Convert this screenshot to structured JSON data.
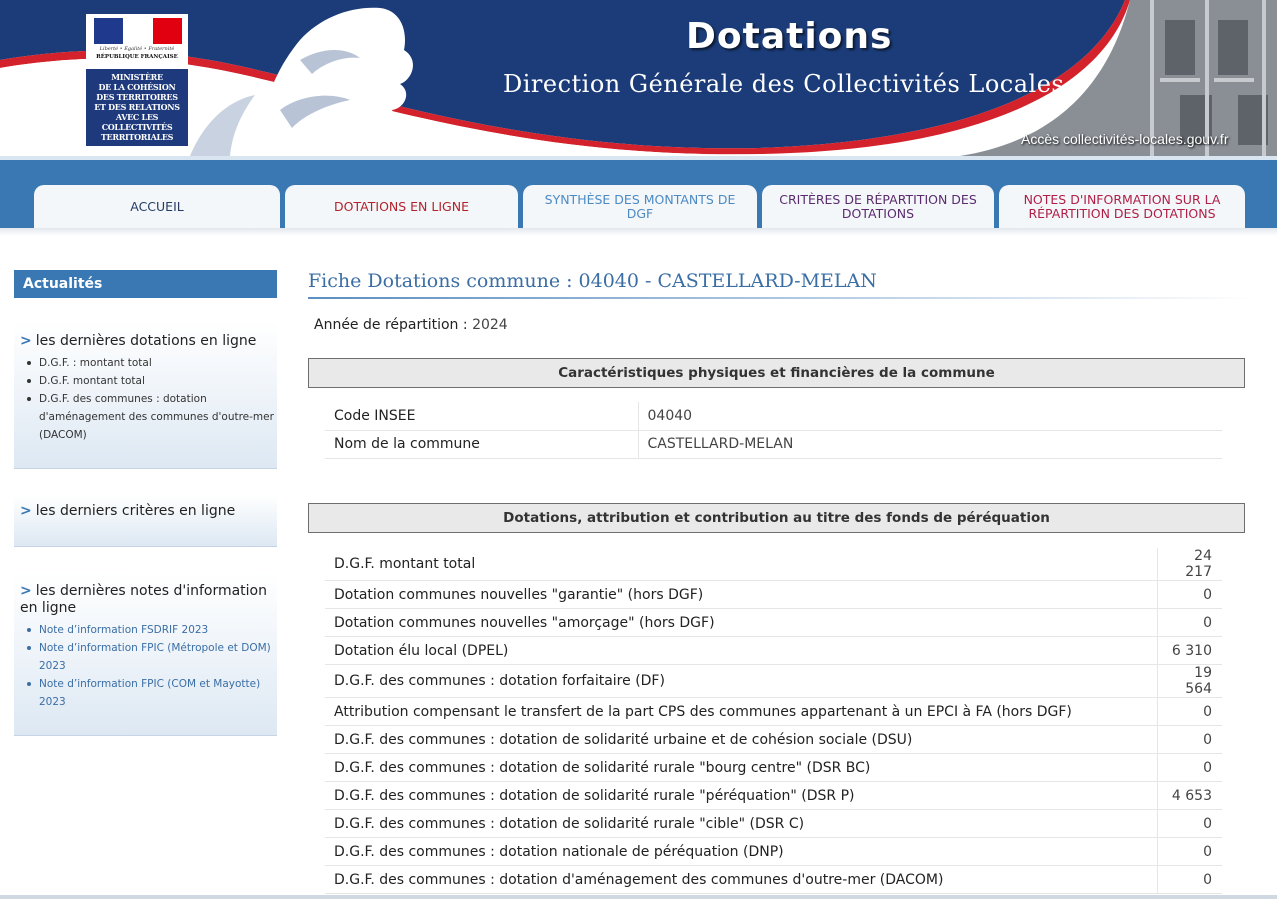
{
  "colors": {
    "banner_blue": "#1b3c78",
    "banner_red": "#d3222b",
    "nav_blue": "#3a78b4",
    "title_blue": "#3a6ea5"
  },
  "header": {
    "logo": {
      "devise": "Liberté • Égalité • Fraternité",
      "republique": "RÉPUBLIQUE FRANÇAISE",
      "ministere": "MINISTÈRE\nDE LA COHÉSION\nDES TERRITOIRES\nET DES RELATIONS\nAVEC LES\nCOLLECTIVITÉS\nTERRITORIALES"
    },
    "title": "Dotations",
    "subtitle": "Direction Générale des Collectivités Locales",
    "access_link": "Accès collectivités-locales.gouv.fr"
  },
  "nav": {
    "tabs": [
      {
        "label": "ACCUEIL"
      },
      {
        "label": "DOTATIONS EN LIGNE"
      },
      {
        "label": "SYNTHÈSE DES MONTANTS DE DGF"
      },
      {
        "label": "CRITÈRES DE RÉPARTITION DES DOTATIONS"
      },
      {
        "label": "NOTES D'INFORMATION SUR LA RÉPARTITION DES DOTATIONS"
      }
    ]
  },
  "sidebar": {
    "header": "Actualités",
    "chevron": ">",
    "dotations": {
      "title": "les dernières dotations en ligne",
      "items": [
        "D.G.F. : montant total",
        "D.G.F. montant total",
        "D.G.F. des communes : dotation d'aménagement des communes d'outre-mer (DACOM)"
      ]
    },
    "criteres": {
      "title": "les derniers critères en ligne"
    },
    "notes": {
      "title": "les dernières notes d'information en ligne",
      "items": [
        "Note d’information FSDRIF 2023",
        "Note d’information FPIC (Métropole et DOM) 2023",
        "Note d’information FPIC (COM et Mayotte) 2023"
      ]
    }
  },
  "main": {
    "title": "Fiche Dotations commune : 04040 - CASTELLARD-MELAN",
    "year_label": "Année de répartition :",
    "year_value": "2024",
    "section1": {
      "title": "Caractéristiques physiques et financières de la commune",
      "rows": [
        {
          "label": "Code INSEE",
          "value": "04040"
        },
        {
          "label": "Nom de la commune",
          "value": "CASTELLARD-MELAN"
        }
      ]
    },
    "section2": {
      "title": "Dotations, attribution et contribution au titre des fonds de péréquation",
      "rows": [
        {
          "label": "D.G.F. montant total",
          "value": "24 217"
        },
        {
          "label": "Dotation communes nouvelles \"garantie\" (hors DGF)",
          "value": "0"
        },
        {
          "label": "Dotation communes nouvelles \"amorçage\" (hors DGF)",
          "value": "0"
        },
        {
          "label": "Dotation élu local (DPEL)",
          "value": "6 310"
        },
        {
          "label": "D.G.F. des communes : dotation forfaitaire (DF)",
          "value": "19 564"
        },
        {
          "label": "Attribution compensant le transfert de la part CPS des communes appartenant à un EPCI à FA (hors DGF)",
          "value": "0"
        },
        {
          "label": "D.G.F. des communes : dotation de solidarité urbaine et de cohésion sociale (DSU)",
          "value": "0"
        },
        {
          "label": "D.G.F. des communes : dotation de solidarité rurale \"bourg centre\" (DSR BC)",
          "value": "0"
        },
        {
          "label": "D.G.F. des communes : dotation de solidarité rurale \"péréquation\" (DSR P)",
          "value": "4 653"
        },
        {
          "label": "D.G.F. des communes : dotation de solidarité rurale \"cible\" (DSR C)",
          "value": "0"
        },
        {
          "label": "D.G.F. des communes : dotation nationale de péréquation (DNP)",
          "value": "0"
        },
        {
          "label": "D.G.F. des communes : dotation d'aménagement des communes d'outre-mer (DACOM)",
          "value": "0"
        }
      ]
    }
  }
}
